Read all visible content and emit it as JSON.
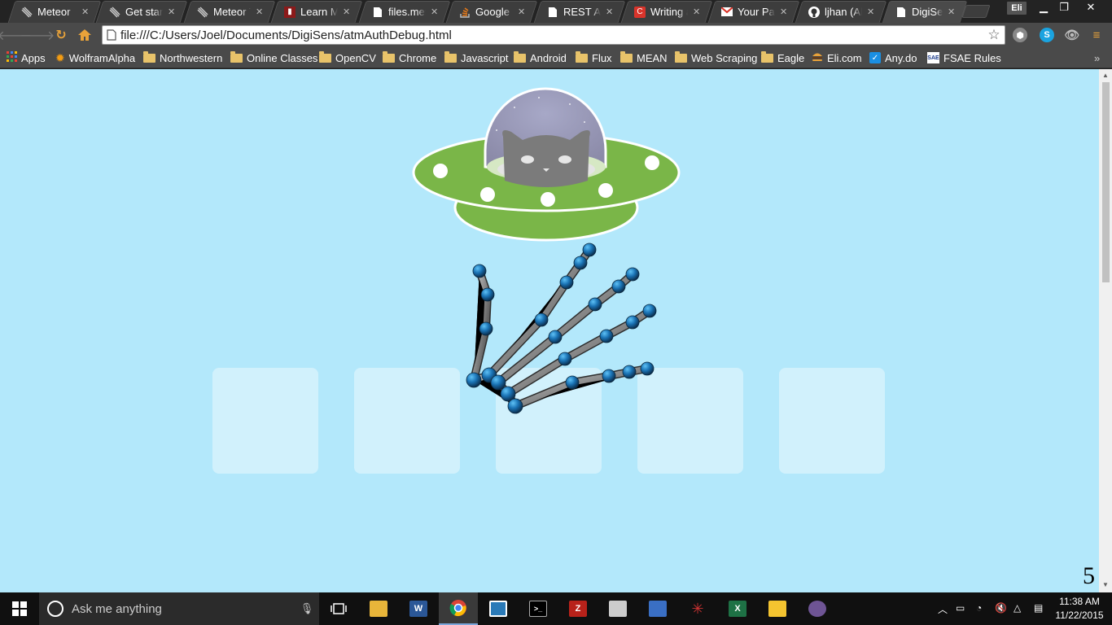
{
  "tabs": [
    {
      "title": "Meteor",
      "icon": "meteor-icon"
    },
    {
      "title": "Get started with Meteor",
      "icon": "meteor-icon"
    },
    {
      "title": "Meteor Tutorial",
      "icon": "meteor-icon"
    },
    {
      "title": "Learn Meteor",
      "icon": "learn-icon"
    },
    {
      "title": "files.meteor",
      "icon": "document-icon"
    },
    {
      "title": "Google Cloud",
      "icon": "stackoverflow-icon"
    },
    {
      "title": "REST API",
      "icon": "document-icon"
    },
    {
      "title": "Writing an",
      "icon": "c-icon"
    },
    {
      "title": "Your Password",
      "icon": "gmail-icon"
    },
    {
      "title": "ljhan (Alyssa)",
      "icon": "github-icon"
    },
    {
      "title": "DigiSens",
      "icon": "document-icon",
      "active": true
    }
  ],
  "profile": {
    "name": "Eli"
  },
  "address_bar": {
    "url": "file:///C:/Users/Joel/Documents/DigiSens/atmAuthDebug.html"
  },
  "bookmarks": [
    {
      "label": "Apps",
      "icon": "apps-grid-icon"
    },
    {
      "label": "WolframAlpha",
      "icon": "wolfram-icon"
    },
    {
      "label": "Northwestern",
      "icon": "folder-icon"
    },
    {
      "label": "Online Classes",
      "icon": "folder-icon"
    },
    {
      "label": "OpenCV",
      "icon": "folder-icon"
    },
    {
      "label": "Chrome",
      "icon": "folder-icon"
    },
    {
      "label": "Javascript",
      "icon": "folder-icon"
    },
    {
      "label": "Android",
      "icon": "folder-icon"
    },
    {
      "label": "Flux",
      "icon": "folder-icon"
    },
    {
      "label": "MEAN",
      "icon": "folder-icon"
    },
    {
      "label": "Web Scraping",
      "icon": "folder-icon"
    },
    {
      "label": "Eagle",
      "icon": "folder-icon"
    },
    {
      "label": "Eli.com",
      "icon": "burger-icon"
    },
    {
      "label": "Any.do",
      "icon": "checkmark-icon"
    },
    {
      "label": "FSAE Rules",
      "icon": "sae-icon"
    }
  ],
  "page": {
    "counter": "5",
    "slot_count": 5
  },
  "taskbar": {
    "search_placeholder": "Ask me anything",
    "time": "11:38 AM",
    "date": "11/22/2015"
  },
  "colors": {
    "page_background": "#b3e8fb",
    "slot": "#d1f1fc",
    "ufo_green": "#7ab648",
    "joint_blue": "#1a73b5"
  }
}
